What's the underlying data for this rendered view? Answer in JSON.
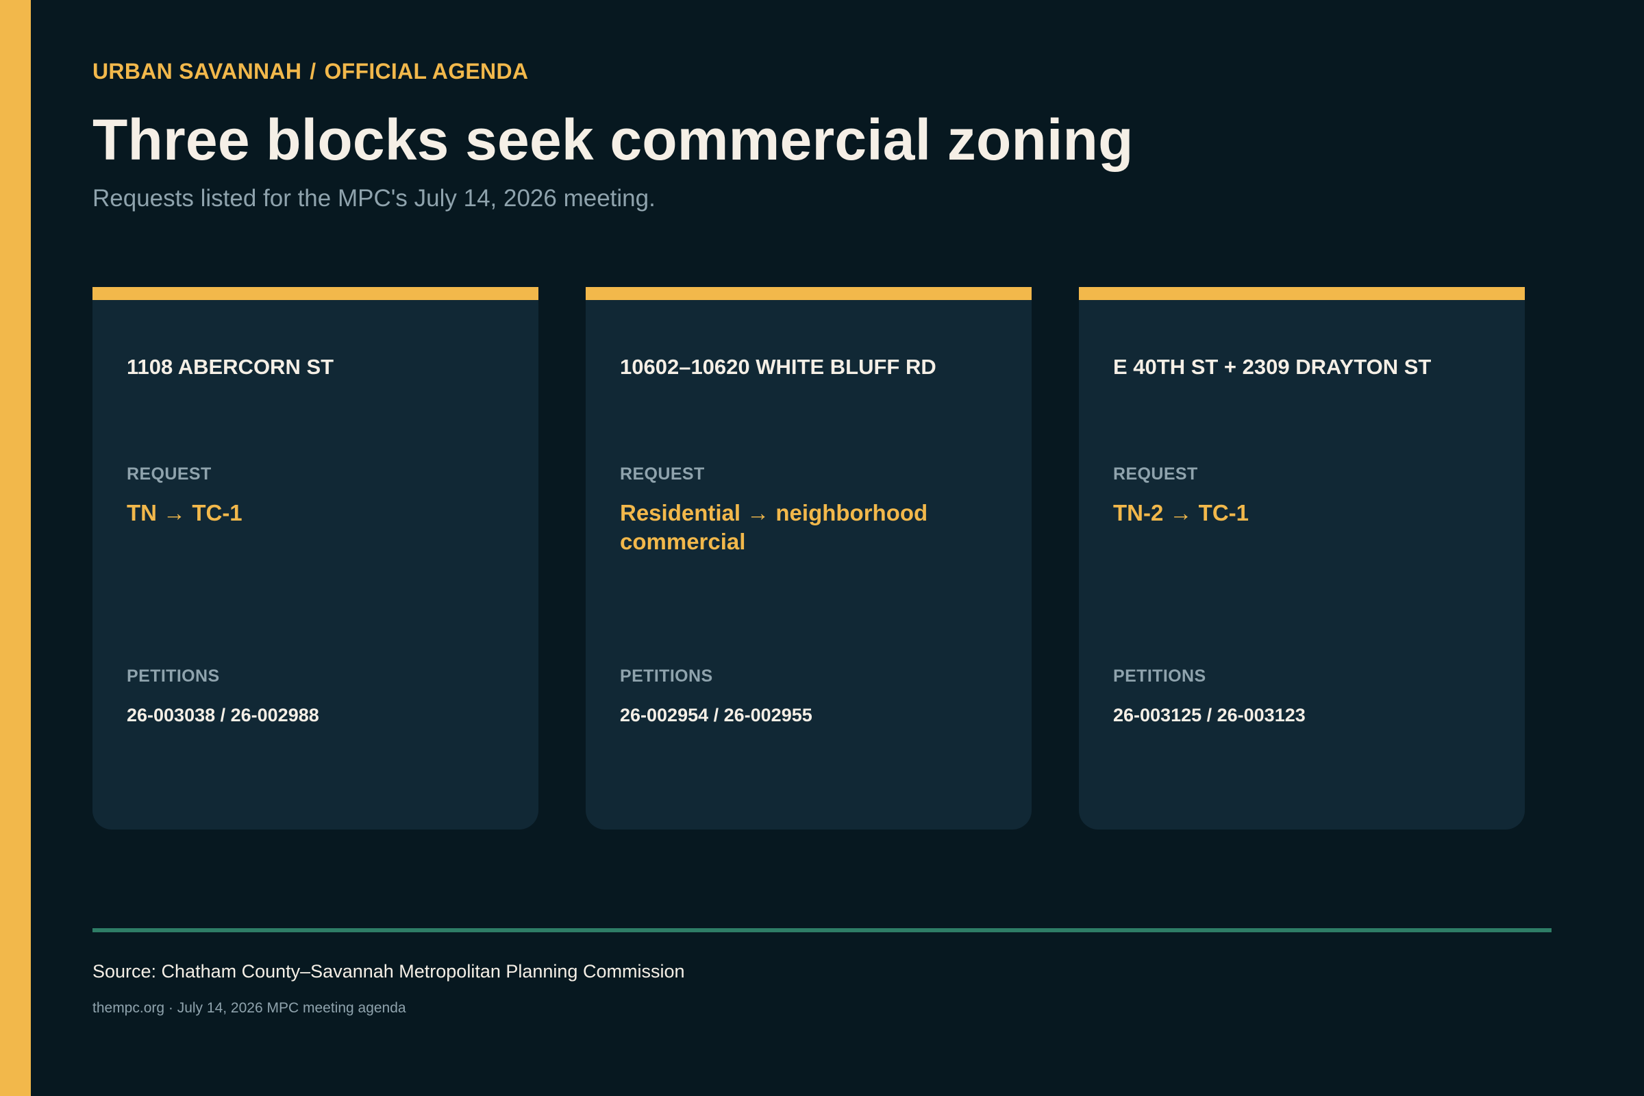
{
  "header": {
    "publication": "URBAN SAVANNAH",
    "separator": "/",
    "section": "OFFICIAL AGENDA",
    "title": "Three blocks seek commercial zoning",
    "subtitle": "Requests listed for the MPC's July 14, 2026 meeting."
  },
  "cards": [
    {
      "address": "1108 ABERCORN ST",
      "request_label": "REQUEST",
      "request": "TN → TC-1",
      "petitions_label": "PETITIONS",
      "petitions": "26-003038 / 26-002988"
    },
    {
      "address": "10602–10620 WHITE BLUFF RD",
      "request_label": "REQUEST",
      "request": "Residential → neighborhood commercial",
      "petitions_label": "PETITIONS",
      "petitions": "26-002954 / 26-002955"
    },
    {
      "address": "E 40TH ST + 2309 DRAYTON ST",
      "request_label": "REQUEST",
      "request": "TN-2 → TC-1",
      "petitions_label": "PETITIONS",
      "petitions": "26-003125 / 26-003123"
    }
  ],
  "footer": {
    "source": "Source: Chatham County–Savannah Metropolitan Planning Commission",
    "note": "thempc.org · July 14, 2026 MPC meeting agenda"
  },
  "colors": {
    "background": "#071820",
    "card": "#112835",
    "accent": "#F2B84B",
    "divider": "#2E7D66",
    "text": "#F5EFE6",
    "muted": "#8FA3AD"
  }
}
